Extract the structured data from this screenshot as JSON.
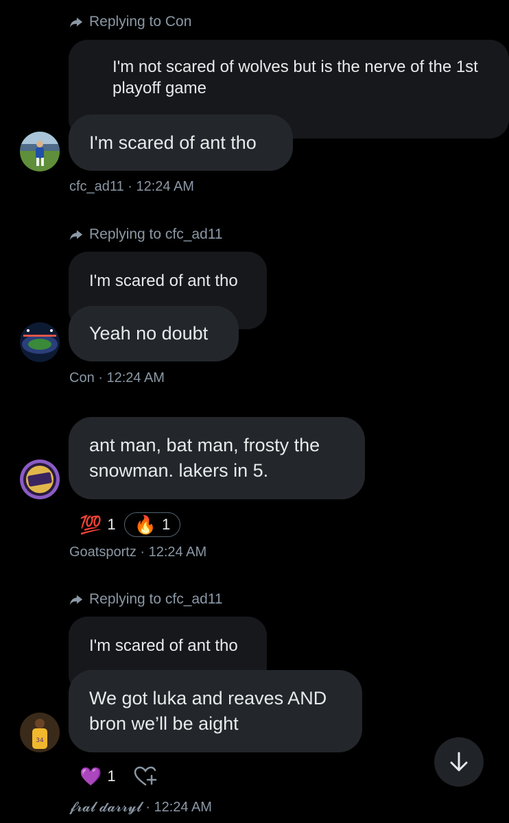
{
  "messages": [
    {
      "replying_to": "Replying to Con",
      "quoted_text": "I'm not scared of wolves but is the nerve of the 1st playoff game",
      "text": "I'm scared of ant tho",
      "meta": "cfc_ad11 · 12:24 AM"
    },
    {
      "replying_to": "Replying to cfc_ad11",
      "quoted_text": "I'm scared of ant tho",
      "text": "Yeah no doubt",
      "meta": "Con · 12:24 AM"
    },
    {
      "text": "ant man, bat man, frosty the snowman. lakers in 5.",
      "reactions": [
        {
          "emoji": "💯",
          "count": "1"
        },
        {
          "emoji": "🔥",
          "count": "1"
        }
      ],
      "meta": "Goatsportz · 12:24 AM"
    },
    {
      "replying_to": "Replying to cfc_ad11",
      "quoted_text": "I'm scared of ant tho",
      "text": "We got luka and reaves AND bron we’ll be aight",
      "reactions": [
        {
          "emoji": "💜",
          "count": "1"
        }
      ],
      "meta": "𝓯𝓻𝓪𝓵 𝓭𝓪𝓻𝓻𝔂𝓵 · 12:24 AM"
    }
  ],
  "colors": {
    "background": "#000000",
    "bubble": "#23272b",
    "quoted_bubble": "#16181c",
    "meta_text": "#8b98a5"
  },
  "icons": [
    "reply-arrow-icon",
    "add-reaction-icon",
    "arrow-down-icon"
  ]
}
